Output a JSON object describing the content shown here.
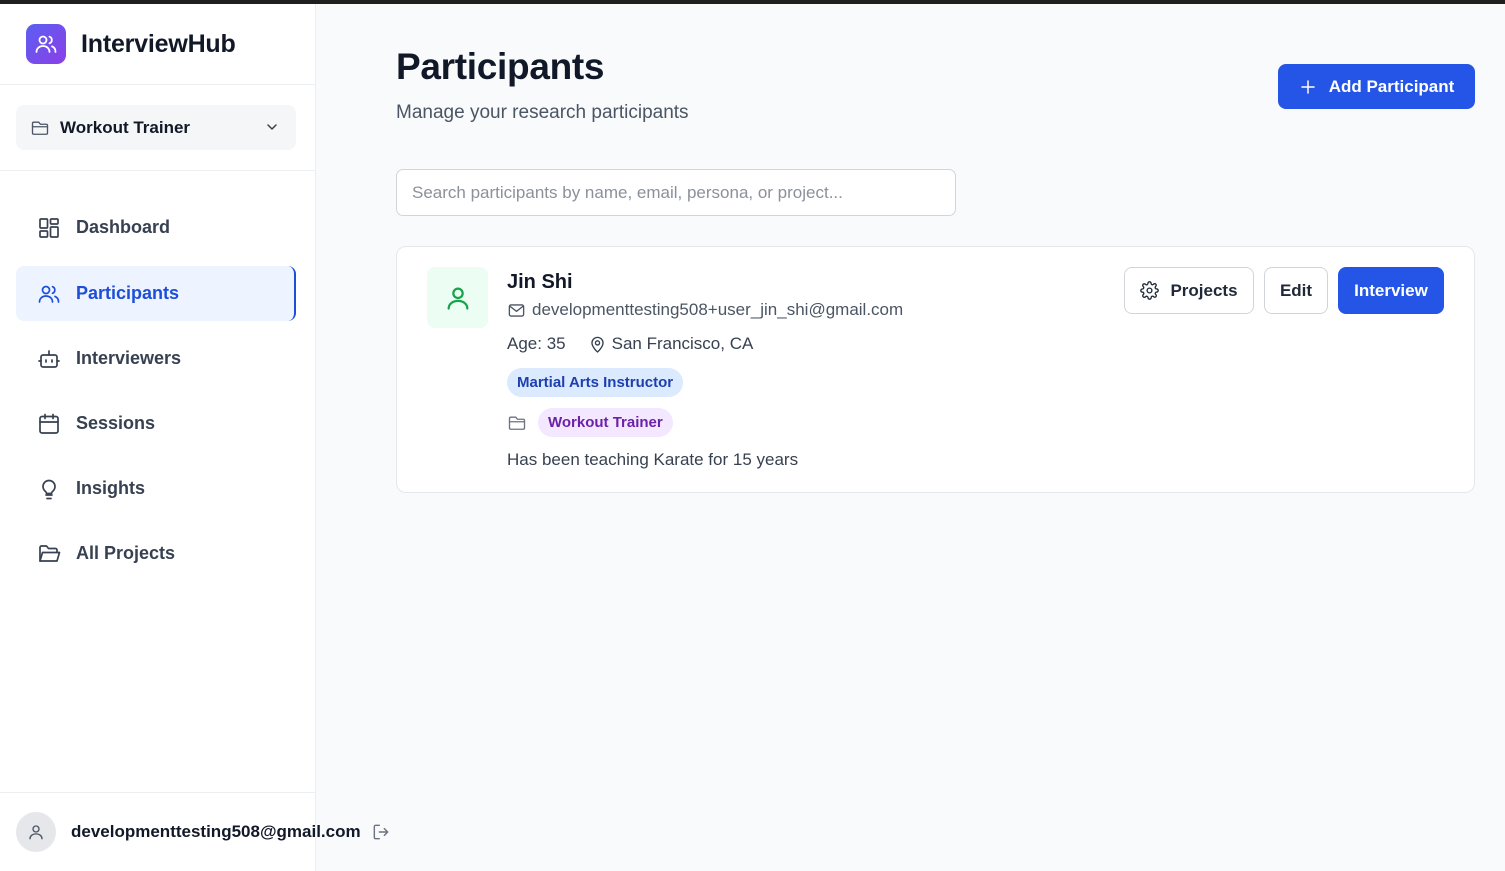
{
  "app": {
    "name": "InterviewHub"
  },
  "sidebar": {
    "project_selector": {
      "value": "Workout Trainer"
    },
    "nav": [
      {
        "key": "dashboard",
        "label": "Dashboard",
        "active": false
      },
      {
        "key": "participants",
        "label": "Participants",
        "active": true
      },
      {
        "key": "interviewers",
        "label": "Interviewers",
        "active": false
      },
      {
        "key": "sessions",
        "label": "Sessions",
        "active": false
      },
      {
        "key": "insights",
        "label": "Insights",
        "active": false
      },
      {
        "key": "all-projects",
        "label": "All Projects",
        "active": false
      }
    ],
    "user": {
      "email": "developmenttesting508@gmail.com"
    }
  },
  "main": {
    "title": "Participants",
    "subtitle": "Manage your research participants",
    "add_button_label": "Add Participant",
    "search": {
      "placeholder": "Search participants by name, email, persona, or project...",
      "value": ""
    },
    "participants": [
      {
        "name": "Jin Shi",
        "email": "developmenttesting508+user_jin_shi@gmail.com",
        "age": "Age: 35",
        "location": "San Francisco, CA",
        "persona": "Martial Arts Instructor",
        "project": "Workout Trainer",
        "note": "Has been teaching Karate for 15 years",
        "actions": {
          "projects": "Projects",
          "edit": "Edit",
          "interview": "Interview"
        }
      }
    ]
  },
  "colors": {
    "primary": "#2455e6",
    "active_nav_bg": "#eef4ff",
    "active_nav_text": "#1d4ed8",
    "persona_badge_bg": "#dbeafe",
    "project_badge_bg": "#f3e8ff",
    "avatar_green": "#16a34a"
  }
}
